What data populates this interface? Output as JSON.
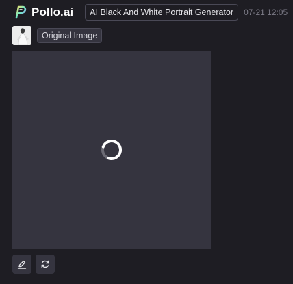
{
  "header": {
    "logo_icon": "pollo-logo-icon",
    "brand": "Pollo.ai",
    "tool_name": "AI Black And White Portrait Generator",
    "timestamp": "07-21 12:05"
  },
  "original": {
    "thumbnail_icon": "portrait-thumbnail",
    "label": "Original Image"
  },
  "result": {
    "status_icon": "loading-spinner-icon"
  },
  "actions": [
    {
      "name": "edit",
      "icon": "edit-pencil-icon"
    },
    {
      "name": "regenerate",
      "icon": "refresh-icon"
    }
  ],
  "colors": {
    "background": "#1e1d23",
    "panel": "#35343f",
    "border": "#4a4956",
    "muted_text": "#7d7c88",
    "spinner_track": "#6b6a74",
    "spinner_arc": "#ffffff"
  }
}
